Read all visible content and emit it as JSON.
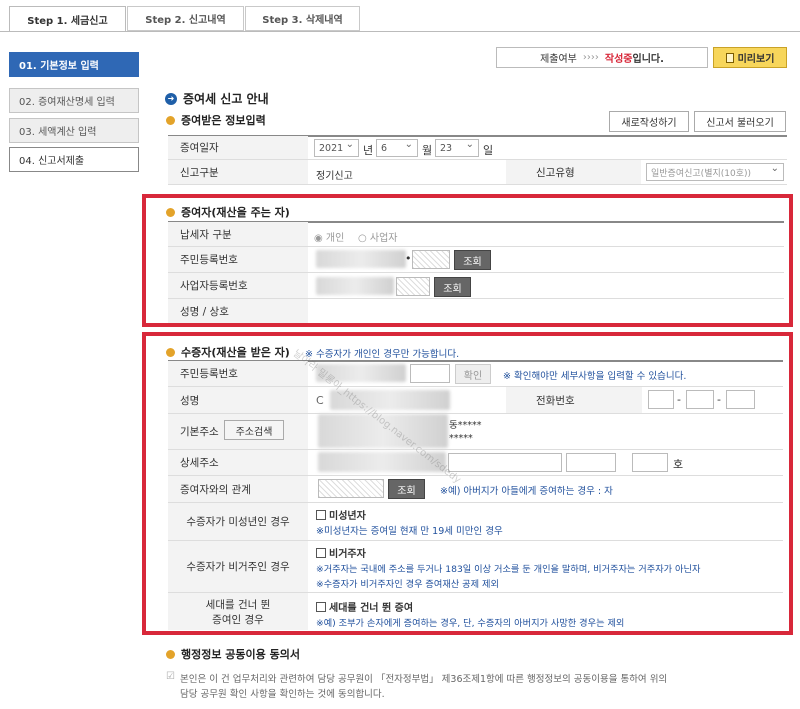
{
  "tabs": [
    "Step 1. 세금신고",
    "Step 2. 신고내역",
    "Step 3. 삭제내역"
  ],
  "sidebar": [
    "01. 기본정보 입력",
    "02. 증여재산명세 입력",
    "03. 세액계산 입력",
    "04. 신고서제출"
  ],
  "status": {
    "label": "제출여부",
    "arrows": "››››",
    "value_red": "작성중",
    "value_suffix": "입니다.",
    "preview": "미리보기"
  },
  "main_title": "증여세 신고 안내",
  "received": {
    "title": "증여받은 정보입력",
    "new_btn": "새로작성하기",
    "load_btn": "신고서 불러오기",
    "date_label": "증여일자",
    "year": "2021",
    "year_unit": "년",
    "month": "6",
    "month_unit": "월",
    "day": "23",
    "day_unit": "일",
    "type_label": "신고구분",
    "type_value": "정기신고",
    "kind_label": "신고유형",
    "kind_value": "일반증여신고(별지(10호))"
  },
  "donor": {
    "title": "증여자(재산을 주는 자)",
    "taxpayer_label": "납세자 구분",
    "opt_person": "개인",
    "opt_biz": "사업자",
    "rrn_label": "주민등록번호",
    "rrn_dot": "•",
    "rrn_btn": "조회",
    "biz_label": "사업자등록번호",
    "biz_btn": "조회",
    "name_label": "성명 / 상호"
  },
  "donee": {
    "title": "수증자(재산을 받은 자)",
    "title_note": "※ 수증자가 개인인 경우만 가능합니다.",
    "rrn_label": "주민등록번호",
    "rrn_btn": "확인",
    "rrn_note": "※ 확인해야만 세부사항을 입력할 수 있습니다.",
    "name_label": "성명",
    "name_partial": "C",
    "phone_label": "전화번호",
    "phone_dash": "-",
    "addr_label": "기본주소",
    "addr_btn": "주소검색",
    "addr_line1": "동*****",
    "addr_line2": "*****",
    "detail_label": "상세주소",
    "detail_suffix": "호",
    "rel_label": "증여자와의 관계",
    "rel_btn": "조회",
    "rel_note": "※예) 아버지가 아들에게 증여하는 경우 : 자",
    "minor_label": "수증자가 미성년인 경우",
    "minor_chk": "미성년자",
    "minor_note": "※미성년자는 증여일 현재 만 19세 미만인 경우",
    "nonres_label": "수증자가 비거주인 경우",
    "nonres_chk": "비거주자",
    "nonres_note1": "※거주자는 국내에 주소를 두거나 183일 이상 거소를 둔 개인을 말하며, 비거주자는 거주자가 아닌자",
    "nonres_note2": "※수증자가 비거주자인 경우 증여재산 공제 제외",
    "gen_label1": "세대를 건너 뛴",
    "gen_label2": "증여인 경우",
    "gen_chk": "세대를 건너 뛴 증여",
    "gen_note": "※예) 조부가 손자에게 증여하는 경우, 단, 수증자의 아버지가 사망한 경우는 제외"
  },
  "consent": {
    "title": "행정정보 공동이용 동의서",
    "line1": "본인은 이 건 업무처리와 관련하여 담당 공무원이 「전자정부법」 제36조제1항에 따른 행정정보의 공동이용을 통하여 위의",
    "line2": "담당 공무원 확인 사항을 확인하는 것에 동의합니다."
  },
  "watermark": "날아라 밀롱아_https://blog.naver.com/sdedy",
  "colors": {
    "highlight_border": "#d8283a",
    "active_side": "#2f68b5",
    "note_blue": "#1f4f9c",
    "status_red": "#d8283a"
  }
}
